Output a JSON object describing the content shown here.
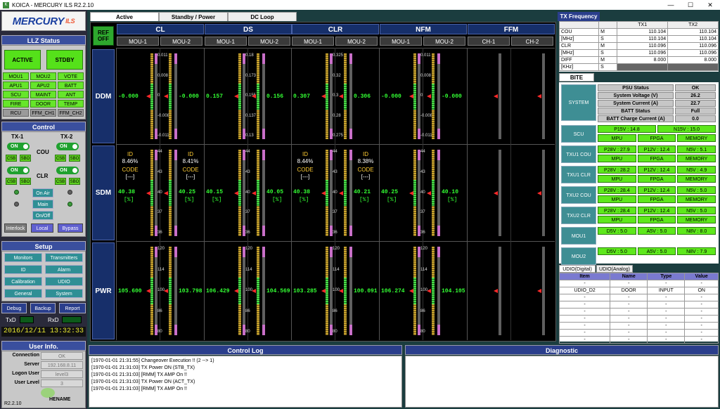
{
  "window": {
    "title": "KOICA - MERCURY ILS  R2.2.10",
    "minimize": "—",
    "maximize": "☐",
    "close": "✕"
  },
  "logo": {
    "brand": "MERCURY",
    "suffix": "ILS"
  },
  "llz_status": {
    "title": "LLZ Status",
    "active_label": "ACTIVE",
    "stdby_label": "STDBY",
    "grid": [
      [
        "MOU1",
        "MOU2",
        "VOTE"
      ],
      [
        "APU1",
        "APU2",
        "BATT"
      ],
      [
        "SCU",
        "MAINT",
        "ANT"
      ],
      [
        "FIRE",
        "DOOR",
        "TEMP"
      ],
      [
        "RCU",
        "FFM_CH1",
        "FFM_CH2"
      ]
    ]
  },
  "control": {
    "title": "Control",
    "tx1": "TX-1",
    "tx2": "TX-2",
    "on": "ON",
    "cou": "COU",
    "clr": "CLR",
    "csb": "CSB",
    "sbo": "SBO",
    "on_air": "On Air",
    "main": "Main",
    "onoff": "On/Off",
    "interlock": "Interlock",
    "local": "Local",
    "bypass": "Bypass"
  },
  "setup": {
    "title": "Setup",
    "buttons": [
      "Monitors",
      "Transmitters",
      "ID",
      "Alarm",
      "Calibration",
      "UDIO",
      "General",
      "System"
    ],
    "debug": "Debug",
    "backup": "Backup",
    "report": "Report",
    "txd": "TxD",
    "rxd": "RxD",
    "datetime": "2016/12/11 13:32:33"
  },
  "user_info": {
    "title": "User Info.",
    "rows": [
      {
        "label": "Connection",
        "value": "OK"
      },
      {
        "label": "Server",
        "value": "192.168.8.11"
      },
      {
        "label": "Logon User",
        "value": "level3"
      },
      {
        "label": "User Level",
        "value": "3"
      }
    ],
    "brand": "HENAME",
    "version": "R2.2.10"
  },
  "tabs": [
    "Active",
    "Standby / Power",
    "DC Loop"
  ],
  "ref_off": "REF\nOFF",
  "groups": [
    {
      "name": "CL",
      "subs": [
        "MOU-1",
        "MOU-2"
      ]
    },
    {
      "name": "DS",
      "subs": [
        "MOU-1",
        "MOU-2"
      ]
    },
    {
      "name": "CLR",
      "subs": [
        "MOU-1",
        "MOU-2"
      ]
    },
    {
      "name": "NFM",
      "subs": [
        "MOU-1",
        "MOU-2"
      ]
    },
    {
      "name": "FFM",
      "subs": [
        "CH-1",
        "CH-2"
      ]
    }
  ],
  "rows": {
    "ddm": "DDM",
    "sdm": "SDM",
    "pwr": "PWR"
  },
  "ddm": {
    "values": [
      "-0.000",
      "-0.000",
      "0.157",
      "0.156",
      "0.307",
      "0.306",
      "-0.000",
      "-0.000"
    ],
    "scales": {
      "cl": [
        "0.011",
        "0.008",
        "0",
        "-0.008",
        "-0.011"
      ],
      "ds": [
        "0.18",
        "0.173",
        "0.155",
        "0.137",
        "0.13"
      ],
      "clr": [
        "0.325",
        "0.32",
        "0.3",
        "0.28",
        "0.275"
      ],
      "nfm": [
        "0.011",
        "0.008",
        "0",
        "-0.008",
        "-0.011"
      ]
    }
  },
  "sdm": {
    "id": [
      "ID",
      "ID",
      "ID",
      "ID"
    ],
    "id_pct": [
      "8.46%",
      "8.41%",
      "8.44%",
      "8.38%"
    ],
    "code": [
      "CODE",
      "CODE",
      "CODE",
      "CODE"
    ],
    "code_val": [
      "[---]",
      "[---]",
      "[---]",
      "[---]"
    ],
    "values": [
      "40.38",
      "40.25",
      "40.15",
      "40.05",
      "40.38",
      "40.21",
      "40.25",
      "40.10"
    ],
    "unit": "[%]",
    "scale": [
      "44",
      "43",
      "40",
      "37",
      "36"
    ]
  },
  "pwr": {
    "values": [
      "105.600",
      "103.798",
      "106.429",
      "104.569",
      "103.285",
      "100.091",
      "106.274",
      "104.105"
    ],
    "scale": [
      "120",
      "114",
      "100",
      "86",
      "80"
    ]
  },
  "tx_frequency": {
    "title": "TX Frequency",
    "headers": [
      "",
      "",
      "TX1",
      "TX2"
    ],
    "rows": [
      [
        "COU",
        "M",
        "110.104",
        "110.104"
      ],
      [
        "[MHz]",
        "S",
        "110.104",
        "110.104"
      ],
      [
        "CLR",
        "M",
        "110.096",
        "110.096"
      ],
      [
        "[MHz]",
        "S",
        "110.096",
        "110.096"
      ],
      [
        "DIFF",
        "M",
        "8.000",
        "8.000"
      ],
      [
        "[KHz]",
        "S",
        "",
        ""
      ]
    ]
  },
  "bite": {
    "tab": "BITE",
    "system_label": "SYSTEM",
    "system_rows": [
      [
        "PSU Status",
        "OK"
      ],
      [
        "System Voltage (V)",
        "26.2"
      ],
      [
        "System Current (A)",
        "22.7"
      ],
      [
        "BATT Status",
        "Full"
      ],
      [
        "BATT Charge Current (A)",
        "0.0"
      ]
    ],
    "modules": [
      {
        "label": "SCU",
        "top": [
          "P15V : 14.8",
          "N15V : 15.0"
        ],
        "bottom": [
          "MPU",
          "FPGA",
          "MEMORY"
        ]
      },
      {
        "label": "TXU1 COU",
        "top": [
          "P28V : 27.9",
          "P12V : 12.4",
          "N5V : 5.1"
        ],
        "bottom": [
          "MPU",
          "FPGA",
          "MEMORY"
        ]
      },
      {
        "label": "TXU1  CLR",
        "top": [
          "P28V : 28.2",
          "P12V : 12.4",
          "N5V : 4.9"
        ],
        "bottom": [
          "MPU",
          "FPGA",
          "MEMORY"
        ]
      },
      {
        "label": "TXU2 COU",
        "top": [
          "P28V : 28.4",
          "P12V : 12.4",
          "N5V : 5.0"
        ],
        "bottom": [
          "MPU",
          "FPGA",
          "MEMORY"
        ]
      },
      {
        "label": "TXU2  CLR",
        "top": [
          "P28V : 28.4",
          "P12V : 12.4",
          "N5V : 5.0"
        ],
        "bottom": [
          "MPU",
          "FPGA",
          "MEMORY"
        ]
      },
      {
        "label": "MOU1",
        "top": [
          "D5V : 5.0",
          "A5V : 5.0",
          "N8V : 8.0"
        ],
        "bottom": []
      },
      {
        "label": "MOU2",
        "top": [
          "D5V : 5.0",
          "A5V : 5.0",
          "N8V : 7.9"
        ],
        "bottom": []
      }
    ]
  },
  "udio": {
    "tabs": [
      "UDIO(Digital)",
      "UDIO(Analog)"
    ],
    "headers": [
      "Item",
      "Name",
      "Type",
      "Value"
    ],
    "rows": [
      [
        "-",
        "-",
        "-",
        "-"
      ],
      [
        "UDIO_D2",
        "DOOR",
        "INPUT",
        "ON"
      ],
      [
        "-",
        "-",
        "-",
        "-"
      ],
      [
        "-",
        "-",
        "-",
        "-"
      ],
      [
        "-",
        "-",
        "-",
        "-"
      ],
      [
        "-",
        "-",
        "-",
        "-"
      ],
      [
        "-",
        "-",
        "-",
        "-"
      ],
      [
        "-",
        "-",
        "-",
        "-"
      ],
      [
        "-",
        "-",
        "-",
        "-"
      ]
    ]
  },
  "control_log": {
    "title": "Control Log",
    "lines": [
      "[1970-01-01 21:31:55]  Changeover Execution !! (2 --> 1)",
      "[1970-01-01 21:31:03]  TX Power ON  (STB_TX)",
      "[1970-01-01 21:31:03]  [RMM] TX AMP On !!",
      "[1970-01-01 21:31:03]  TX Power ON  (ACT_TX)",
      "[1970-01-01 21:31:03]  [RMM] TX AMP On !!"
    ]
  },
  "diagnostic": {
    "title": "Diagnostic"
  }
}
